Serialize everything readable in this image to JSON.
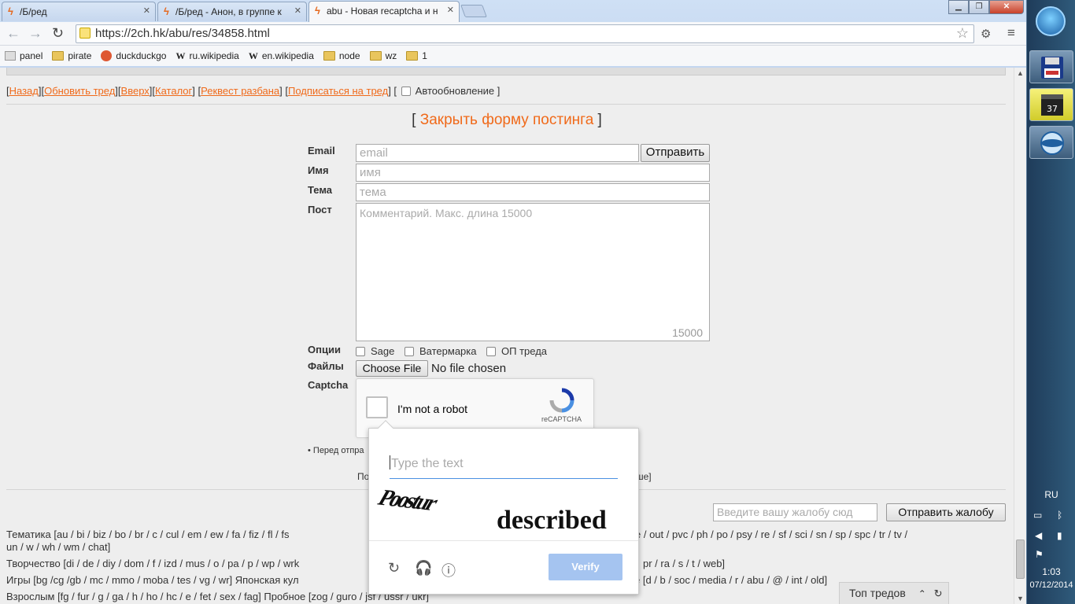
{
  "browser": {
    "tabs": [
      {
        "title": "/Б/ред"
      },
      {
        "title": "/Б/ред - Анон, в группе к"
      },
      {
        "title": "abu - Новая recaptcha и н"
      }
    ],
    "url": "https://2ch.hk/abu/res/34858.html",
    "bookmarks": [
      "panel",
      "pirate",
      "duckduckgo",
      "ru.wikipedia",
      "en.wikipedia",
      "node",
      "wz",
      "1"
    ]
  },
  "nav": {
    "back": "Назад",
    "refresh": "Обновить тред",
    "up": "Вверх",
    "catalog": "Каталог",
    "request": "Реквест разбана",
    "subscribe": "Подписаться на тред",
    "autoupdate": "Автообновление"
  },
  "form": {
    "close_label": "Закрыть форму постинга",
    "email_label": "Email",
    "email_placeholder": "email",
    "send_label": "Отправить",
    "name_label": "Имя",
    "name_placeholder": "имя",
    "subject_label": "Тема",
    "subject_placeholder": "тема",
    "post_label": "Пост",
    "post_placeholder": "Комментарий. Макс. длина 15000",
    "post_counter": "15000",
    "options_label": "Опции",
    "options": [
      "Sage",
      "Ватермарка",
      "ОП треда"
    ],
    "files_label": "Файлы",
    "choose_file": "Choose File",
    "no_file": "No file chosen",
    "captcha_label": "Captcha",
    "note": "• Перед отпра",
    "note2": "По",
    "note3": "ше]"
  },
  "recaptcha": {
    "checkbox_label": "I'm not a robot",
    "brand": "reCAPTCHA",
    "type_placeholder": "Type the text",
    "word1": "Poostur",
    "word2": "described",
    "verify": "Verify"
  },
  "complaint": {
    "placeholder": "Введите вашу жалобу сюд",
    "button": "Отправить жалобу"
  },
  "boards": {
    "row1a": "Тематика [au / bi / biz / bo / br / c / cul / em / ew / fa / fiz / fl / fs",
    "row1b": "e / out / pvc / ph / po / psy / re / sf / sci / sn / sp / spc / tr / tv /",
    "row1c": "un / w / wh / wm / chat]",
    "row2a": "Творчество [di / de / diy / dom / f / izd / mus / o / pa / p / wp / wrk",
    "row2b": "pr / ra / s / t / web]",
    "row3a": "Игры [bg /cg /gb / mc / mmo / moba / tes / vg / wr]   Японская кул",
    "row3b": "e [d / b / soc / media / r / abu / @ / int / old]",
    "row4a": "Взрослым [fg / fur / g / ga / h / ho / hc / e / fet / sex / fag]   Пробное [zog / guro / jsf / ussr / ukr]"
  },
  "top_threads": "Топ тредов",
  "taskbar": {
    "lang": "RU",
    "time": "1:03",
    "date": "07/12/2014"
  }
}
